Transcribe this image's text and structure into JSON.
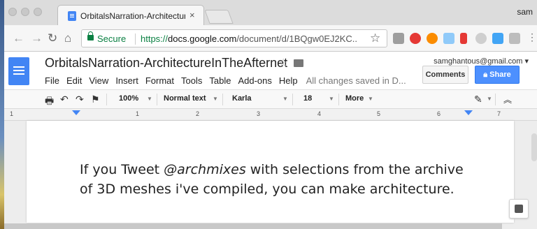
{
  "browser": {
    "tab_title": "OrbitalsNarration-Architecture",
    "tab_close": "×",
    "profile": "sam",
    "secure_label": "Secure",
    "url_scheme": "https://",
    "url_host": "docs.google.com",
    "url_path": "/document/d/1BQgw0EJ2KC...",
    "bookmark_icon": "star-outline-icon"
  },
  "docs": {
    "title": "OrbitalsNarration-ArchitectureInTheAfternet",
    "account": "samghantous@gmail.com ▾",
    "menu": [
      "File",
      "Edit",
      "View",
      "Insert",
      "Format",
      "Tools",
      "Table",
      "Add-ons",
      "Help"
    ],
    "save_status": "All changes saved in D...",
    "comments_label": "Comments",
    "share_label": "Share",
    "accent_color": "#4285f4"
  },
  "format_toolbar": {
    "zoom": "100%",
    "style": "Normal text",
    "font": "Karla",
    "size": "18",
    "more": "More"
  },
  "ruler": {
    "numbers": [
      "1",
      "1",
      "2",
      "3",
      "4",
      "5",
      "6",
      "7"
    ]
  },
  "document": {
    "line1_a": "If you Tweet ",
    "line1_handle": "@archmixes",
    "line1_b": " with selections from the archive",
    "line2": "of 3D meshes i've compiled, you can make architecture."
  }
}
